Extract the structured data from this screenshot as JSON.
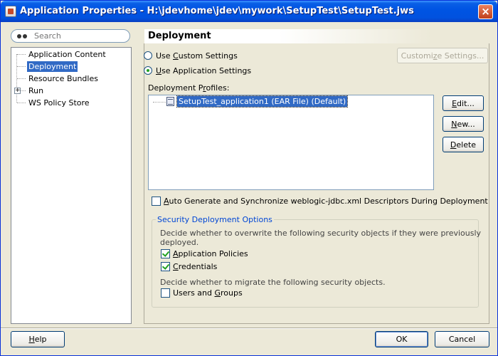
{
  "window": {
    "title": "Application Properties - H:\\jdevhome\\jdev\\mywork\\SetupTest\\SetupTest.jws",
    "close_glyph": "×"
  },
  "search": {
    "placeholder": "Search"
  },
  "tree": {
    "items": [
      {
        "label": "Application Content",
        "selected": false,
        "expandable": false
      },
      {
        "label": "Deployment",
        "selected": true,
        "expandable": false
      },
      {
        "label": "Resource Bundles",
        "selected": false,
        "expandable": false
      },
      {
        "label": "Run",
        "selected": false,
        "expandable": true
      },
      {
        "label": "WS Policy Store",
        "selected": false,
        "expandable": false
      }
    ]
  },
  "page": {
    "heading": "Deployment"
  },
  "settings": {
    "custom": {
      "pre": "Use ",
      "mnemonic": "C",
      "post": "ustom Settings",
      "checked": false
    },
    "application": {
      "pre": "",
      "mnemonic": "U",
      "post": "se Application Settings",
      "checked": true
    },
    "customize_button": {
      "pre": "Customi",
      "mnemonic": "z",
      "post": "e Settings...",
      "enabled": false
    }
  },
  "profiles": {
    "label_pre": "Deployment P",
    "label_mnemonic": "r",
    "label_post": "ofiles:",
    "items": [
      "SetupTest_application1 (EAR File) (Default)"
    ],
    "edit": {
      "mnemonic": "E",
      "post": "dit..."
    },
    "new": {
      "mnemonic": "N",
      "post": "ew..."
    },
    "delete": {
      "mnemonic": "D",
      "post": "elete"
    }
  },
  "auto_generate": {
    "pre": "",
    "mnemonic": "A",
    "post": "uto Generate and Synchronize weblogic-jdbc.xml Descriptors During Deployment",
    "checked": false
  },
  "security": {
    "legend": "Security Deployment Options",
    "overwrite_desc_line1": "Decide whether to overwrite the following security objects if they were previously",
    "overwrite_desc_line2": "deployed.",
    "app_policies": {
      "pre": "",
      "mnemonic": "A",
      "post": "pplication Policies",
      "checked": true
    },
    "credentials": {
      "pre": "",
      "mnemonic": "C",
      "post": "redentials",
      "checked": true
    },
    "migrate_desc": "Decide whether to migrate the following security objects.",
    "users_groups": {
      "pre": "Users and ",
      "mnemonic": "G",
      "post": "roups",
      "checked": false
    }
  },
  "footer": {
    "help": {
      "mnemonic": "H",
      "post": "elp"
    },
    "ok": "OK",
    "cancel": "Cancel"
  },
  "colors": {
    "titlebar": "#0054e3",
    "selection": "#316ac5",
    "legend": "#0046d5",
    "dialog_bg": "#ece9d8"
  }
}
